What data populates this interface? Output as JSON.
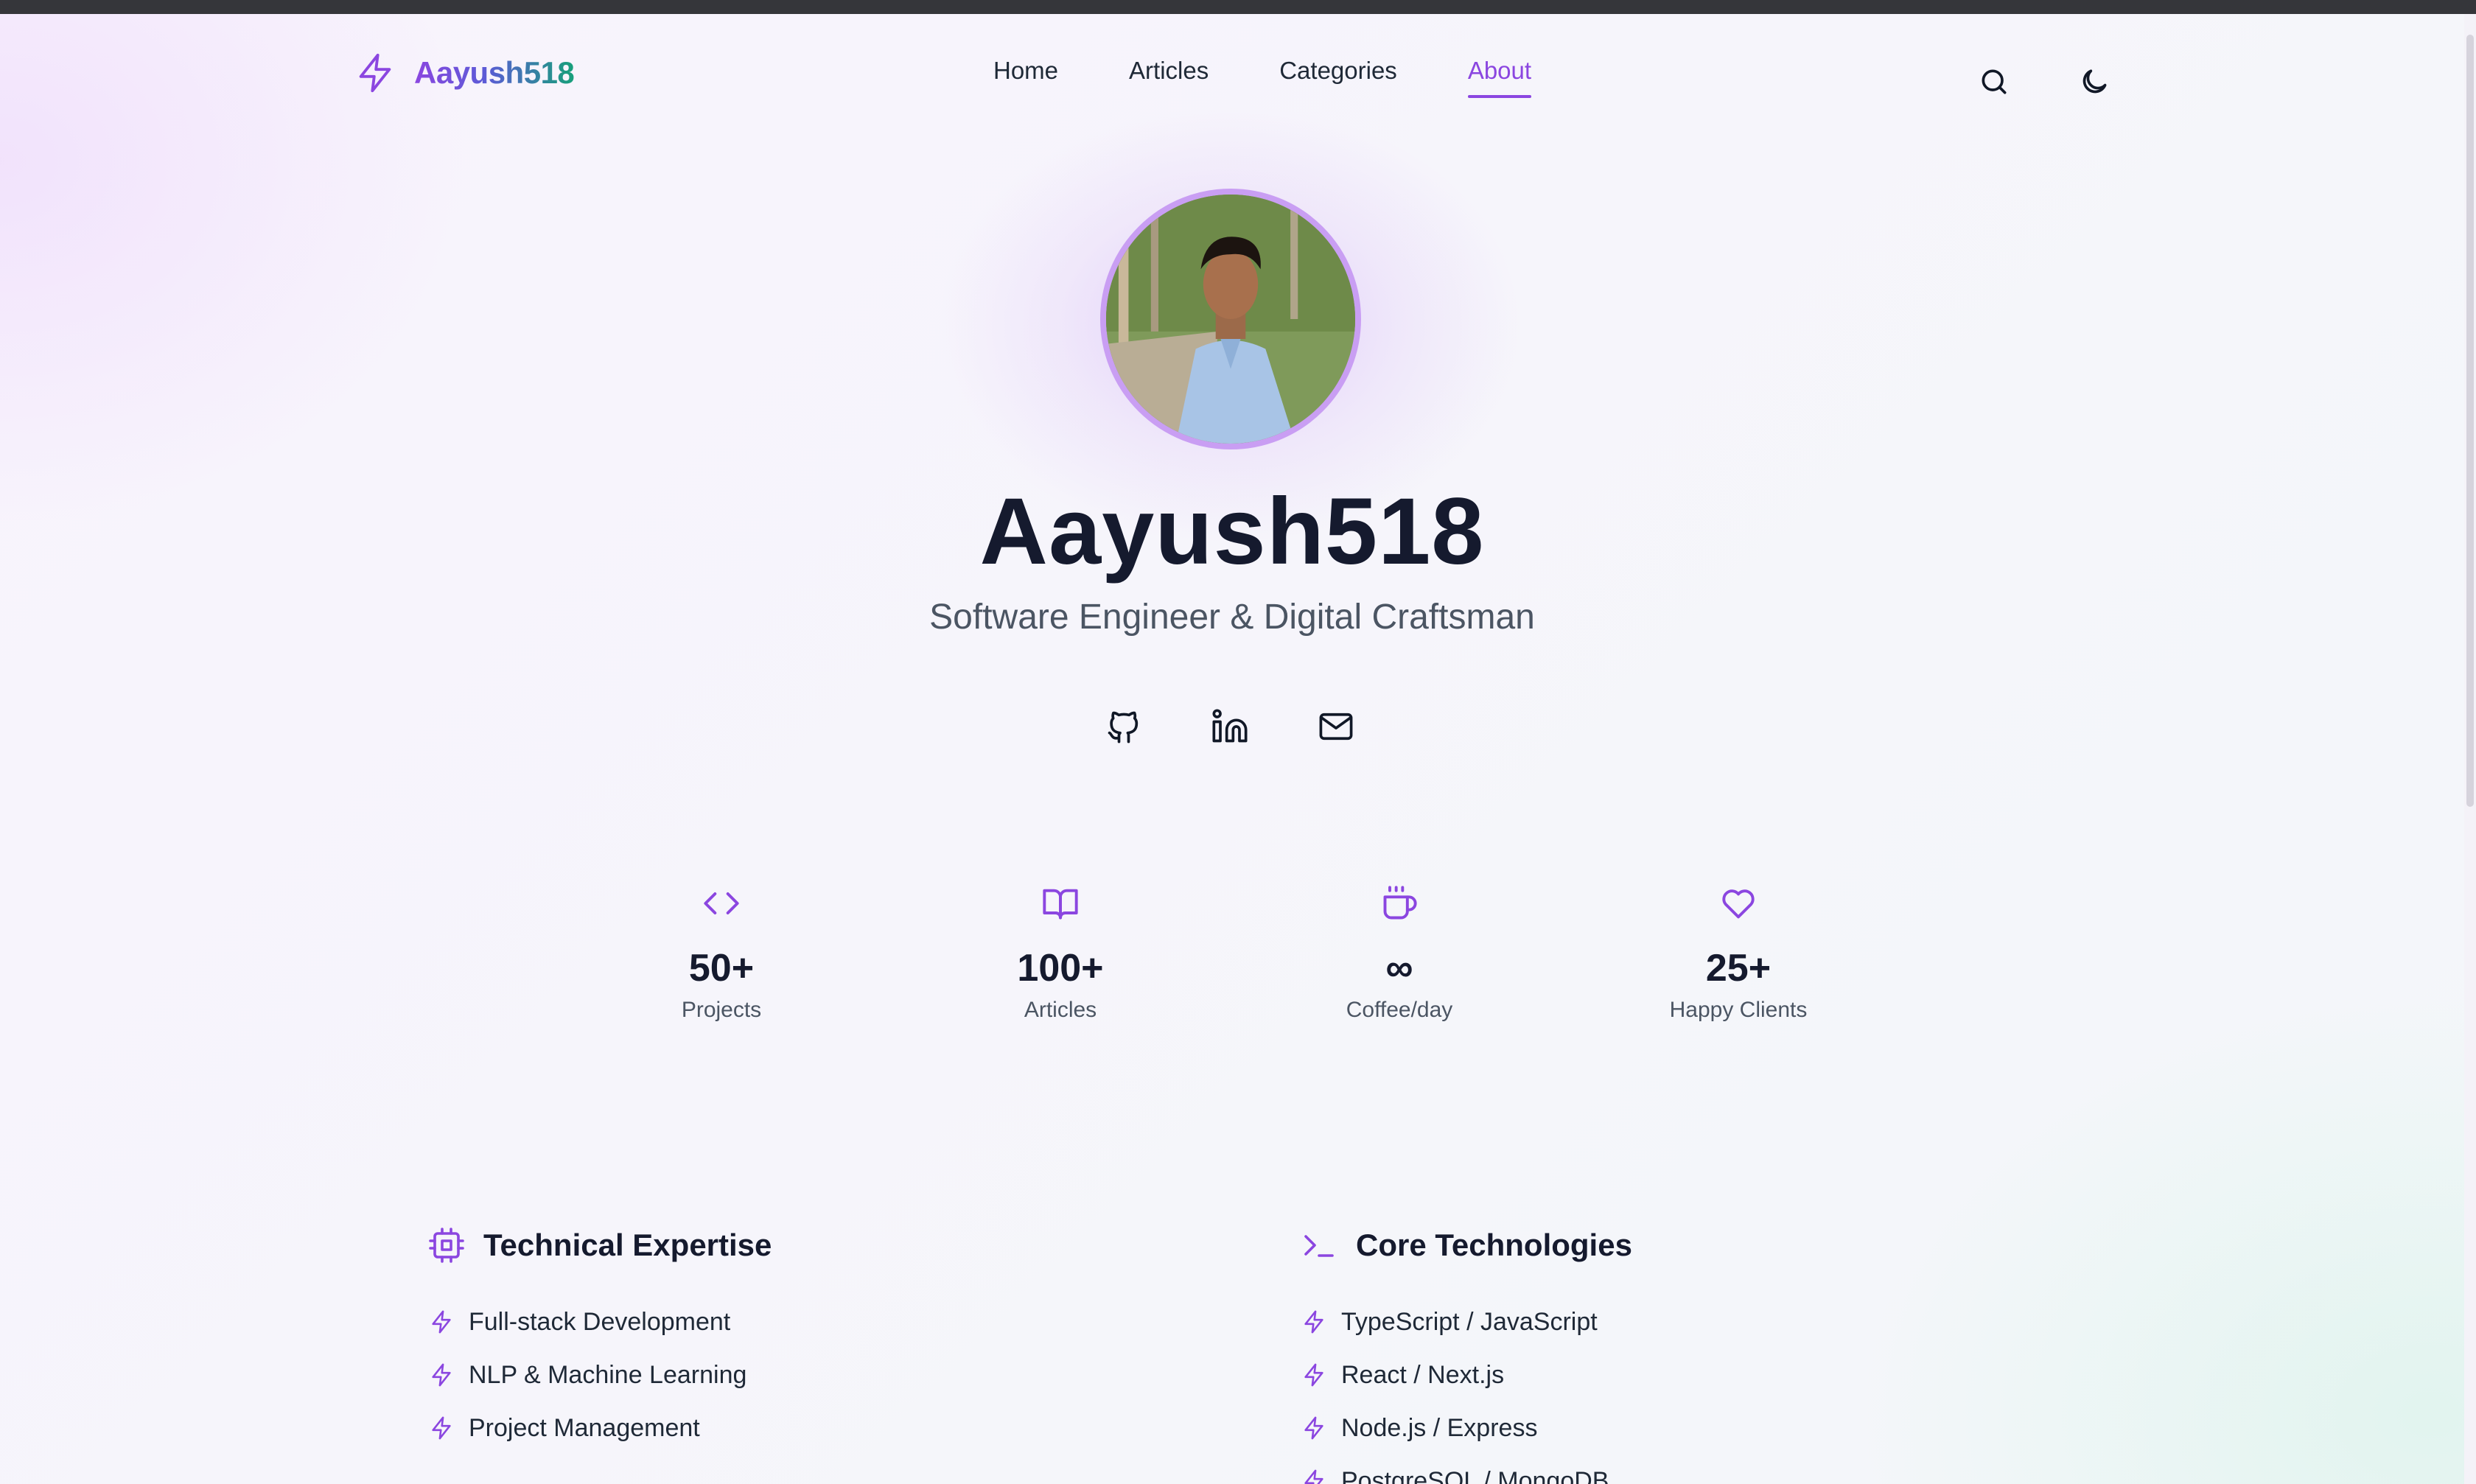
{
  "header": {
    "logo_text": "Aayush518",
    "nav": [
      {
        "label": "Home",
        "active": false
      },
      {
        "label": "Articles",
        "active": false
      },
      {
        "label": "Categories",
        "active": false
      },
      {
        "label": "About",
        "active": true
      }
    ],
    "icons": [
      "search-icon",
      "moon-icon"
    ]
  },
  "hero": {
    "name": "Aayush518",
    "tagline": "Software Engineer & Digital Craftsman",
    "socials": [
      "github-icon",
      "linkedin-icon",
      "mail-icon"
    ]
  },
  "stats": [
    {
      "icon": "code-icon",
      "value": "50+",
      "label": "Projects"
    },
    {
      "icon": "book-icon",
      "value": "100+",
      "label": "Articles"
    },
    {
      "icon": "coffee-icon",
      "value": "∞",
      "label": "Coffee/day"
    },
    {
      "icon": "heart-icon",
      "value": "25+",
      "label": "Happy Clients"
    }
  ],
  "expertise": {
    "title": "Technical Expertise",
    "items": [
      "Full-stack Development",
      "NLP & Machine Learning",
      "Project Management"
    ]
  },
  "technologies": {
    "title": "Core Technologies",
    "items": [
      "TypeScript / JavaScript",
      "React / Next.js",
      "Node.js / Express",
      "PostgreSQL / MongoDB"
    ]
  },
  "colors": {
    "accent": "#8b46e0",
    "logo_gradient_end": "#17a07a",
    "heading": "#151a2e",
    "muted": "#4b5563"
  }
}
